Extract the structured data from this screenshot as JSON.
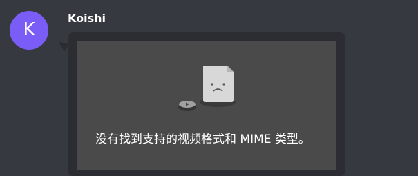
{
  "message": {
    "author": "Koishi",
    "avatar_letter": "K",
    "avatar_color": "#7a5cf6"
  },
  "video": {
    "error_text": "没有找到支持的视频格式和 MIME 类型。",
    "icon": "broken-video-file-icon"
  },
  "colors": {
    "background": "#36393f",
    "bubble": "#2b2d32",
    "video_box": "#4a4a4a"
  }
}
